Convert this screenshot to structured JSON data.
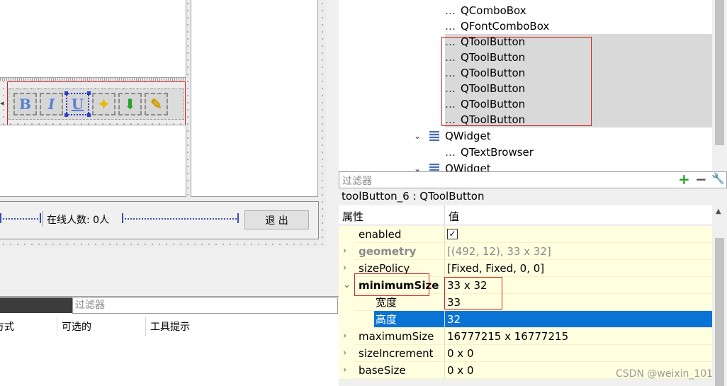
{
  "form": {
    "online_label": "在线人数: 0人",
    "exit_button": "退 出",
    "toolbar_buttons": [
      {
        "icon": "bold-icon",
        "glyph": "B",
        "color": "#5b7fd6"
      },
      {
        "icon": "italic-icon",
        "glyph": "I",
        "color": "#5b7fd6"
      },
      {
        "icon": "underline-icon",
        "glyph": "U",
        "color": "#5b7fd6"
      },
      {
        "icon": "star-color-icon",
        "glyph": "✦",
        "color": "#e6b800"
      },
      {
        "icon": "save-download-icon",
        "glyph": "⬇",
        "color": "#2aa12a"
      },
      {
        "icon": "clear-brush-icon",
        "glyph": "✎",
        "color": "#d49b00"
      }
    ]
  },
  "bottom_panel": {
    "filter_placeholder": "过滤器",
    "columns": [
      "方式",
      "可选的",
      "工具提示"
    ]
  },
  "object_tree": {
    "rows": [
      {
        "indent": "leaf",
        "label": "QComboBox",
        "highlight": false
      },
      {
        "indent": "leaf",
        "label": "QFontComboBox",
        "highlight": false
      },
      {
        "indent": "leaf",
        "label": "QToolButton",
        "highlight": true
      },
      {
        "indent": "leaf",
        "label": "QToolButton",
        "highlight": true
      },
      {
        "indent": "leaf",
        "label": "QToolButton",
        "highlight": true
      },
      {
        "indent": "leaf",
        "label": "QToolButton",
        "highlight": true
      },
      {
        "indent": "leaf",
        "label": "QToolButton",
        "highlight": true
      },
      {
        "indent": "leaf",
        "label": "QToolButton",
        "highlight": true
      },
      {
        "indent": "parent",
        "label": "QWidget",
        "highlight": false
      },
      {
        "indent": "leaf",
        "label": "QTextBrowser",
        "highlight": false
      },
      {
        "indent": "parent",
        "label": "QWidget",
        "highlight": false
      }
    ]
  },
  "property_editor": {
    "filter_placeholder": "过滤器",
    "object_title": "toolButton_6 : QToolButton",
    "header_property": "属性",
    "header_value": "值",
    "rows": [
      {
        "name": "enabled",
        "value": "",
        "checkbox": true,
        "expand": false,
        "style": ""
      },
      {
        "name": "geometry",
        "value": "[(492, 12), 33 x 32]",
        "expand": true,
        "style": "dim bold"
      },
      {
        "name": "sizePolicy",
        "value": "[Fixed, Fixed, 0, 0]",
        "expand": true,
        "style": ""
      },
      {
        "name": "minimumSize",
        "value": "33 x 32",
        "expand": true,
        "expanded": true,
        "style": "bold"
      },
      {
        "name": "宽度",
        "value": "33",
        "expand": false,
        "style": "sub"
      },
      {
        "name": "高度",
        "value": "32",
        "expand": false,
        "style": "sub selected"
      },
      {
        "name": "maximumSize",
        "value": "16777215 x 16777215",
        "expand": true,
        "style": ""
      },
      {
        "name": "sizeIncrement",
        "value": "0 x 0",
        "expand": true,
        "style": ""
      },
      {
        "name": "baseSize",
        "value": "0 x 0",
        "expand": true,
        "style": ""
      }
    ]
  },
  "watermark": "CSDN @weixin_101"
}
